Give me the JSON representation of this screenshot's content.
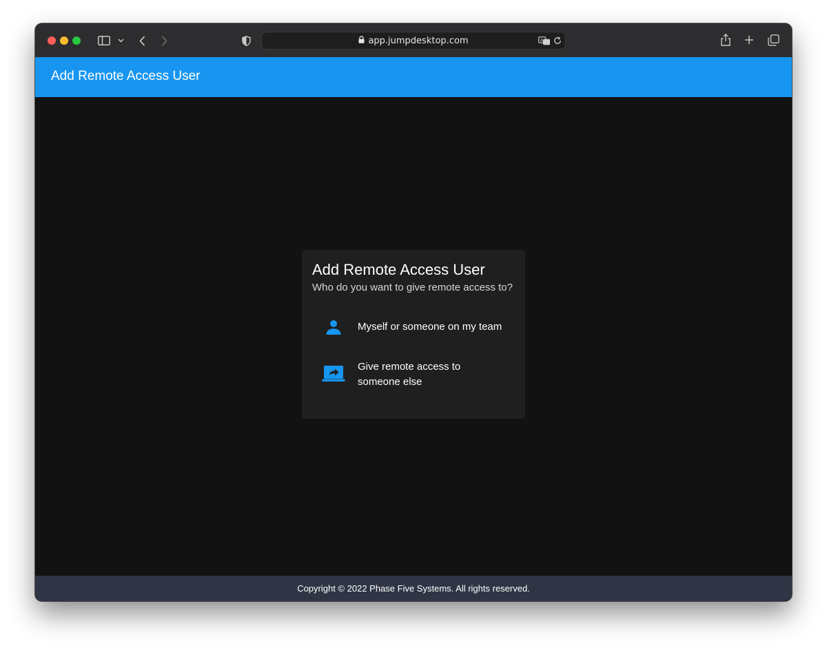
{
  "browser": {
    "url": "app.jumpdesktop.com",
    "icons": {
      "sidebar": "sidebar-icon",
      "chevron": "chevron-down-icon",
      "back": "back-icon",
      "forward": "forward-icon",
      "shield": "shield-icon",
      "lock": "lock-icon",
      "translate": "translate-icon",
      "reload": "reload-icon",
      "share": "share-icon",
      "new_tab": "plus-icon",
      "tabs": "tabs-overview-icon"
    }
  },
  "header": {
    "title": "Add Remote Access User",
    "color": "#1795f0"
  },
  "card": {
    "title": "Add Remote Access User",
    "subtitle": "Who do you want to give remote access to?",
    "options": [
      {
        "label": "Myself or someone on my team",
        "icon": "person-icon"
      },
      {
        "label": "Give remote access to someone else",
        "icon": "laptop-share-icon"
      }
    ],
    "accent": "#1795f0"
  },
  "footer": {
    "text": "Copyright © 2022 Phase Five Systems. All rights reserved."
  }
}
